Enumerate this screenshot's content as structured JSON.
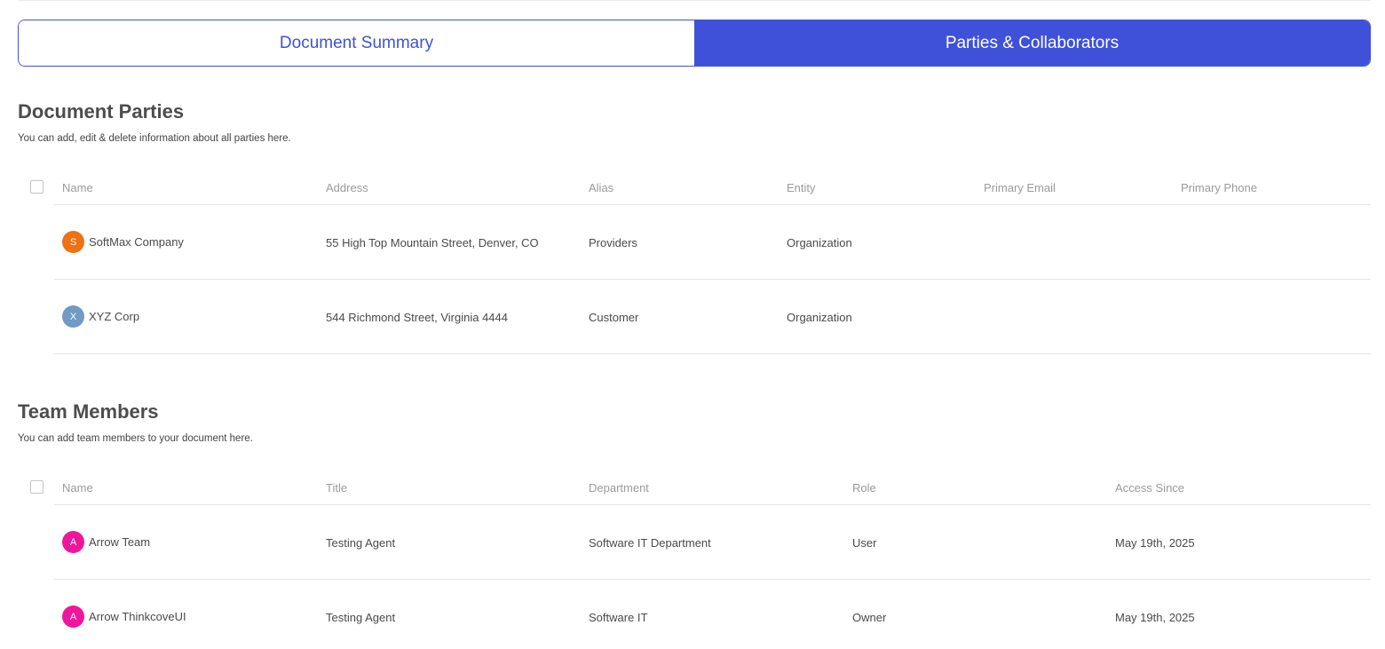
{
  "tabs": [
    {
      "label": "Document Summary",
      "active": false
    },
    {
      "label": "Parties & Collaborators",
      "active": true
    }
  ],
  "parties": {
    "title": "Document Parties",
    "subtitle": "You can add, edit & delete information about all parties here.",
    "columns": [
      "Name",
      "Address",
      "Alias",
      "Entity",
      "Primary Email",
      "Primary Phone"
    ],
    "rows": [
      {
        "initial": "S",
        "avatar_color": "#f07014",
        "name": "SoftMax Company",
        "address": "55 High Top Mountain Street, Denver, CO",
        "alias": "Providers",
        "entity": "Organization",
        "email": "",
        "phone": ""
      },
      {
        "initial": "X",
        "avatar_color": "#6f9bc4",
        "name": "XYZ Corp",
        "address": "544 Richmond Street, Virginia 4444",
        "alias": "Customer",
        "entity": "Organization",
        "email": "",
        "phone": ""
      }
    ]
  },
  "team": {
    "title": "Team Members",
    "subtitle": "You can add team members to your document here.",
    "columns": [
      "Name",
      "Title",
      "Department",
      "Role",
      "Access Since"
    ],
    "rows": [
      {
        "initial": "A",
        "avatar_color": "#f0169c",
        "name": "Arrow Team",
        "title": "Testing Agent",
        "department": "Software IT Department",
        "role": "User",
        "since": "May 19th, 2025"
      },
      {
        "initial": "A",
        "avatar_color": "#f0169c",
        "name": "Arrow ThinkcoveUI",
        "title": "Testing Agent",
        "department": "Software IT",
        "role": "Owner",
        "since": "May 19th, 2025"
      }
    ]
  },
  "colors": {
    "accent": "#3f51d9"
  }
}
